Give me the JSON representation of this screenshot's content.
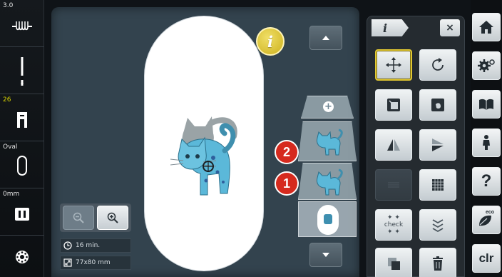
{
  "left_status": {
    "stitch_length_value": "3.0",
    "needle_value": "",
    "thread_value": "26",
    "hoop_value": "Oval",
    "offset_value": "0mm"
  },
  "workspace": {
    "info_button_label": "i",
    "embroidery_time": "16 min.",
    "embroidery_size": "77x80 mm",
    "layer_badges": [
      "2",
      "1"
    ],
    "add_layer_label": "+"
  },
  "tool_panel": {
    "tab_label": "i",
    "close_label": "×",
    "check_label_line1": "✦ ✦",
    "check_label_word": "check",
    "check_label_line2": "✦ ✦",
    "tools": [
      {
        "icon": "move-icon",
        "state": "selected"
      },
      {
        "icon": "rotate-icon",
        "state": "enabled"
      },
      {
        "icon": "resize-icon",
        "state": "enabled"
      },
      {
        "icon": "hoop-layout-icon",
        "state": "enabled"
      },
      {
        "icon": "mirror-horizontal-icon",
        "state": "enabled"
      },
      {
        "icon": "mirror-vertical-icon",
        "state": "enabled"
      },
      {
        "icon": "edit-disabled-icon",
        "state": "disabled"
      },
      {
        "icon": "fill-pattern-icon",
        "state": "enabled"
      },
      {
        "icon": "check-position-icon",
        "state": "enabled"
      },
      {
        "icon": "color-layers-icon",
        "state": "enabled"
      },
      {
        "icon": "duplicate-icon",
        "state": "enabled"
      },
      {
        "icon": "delete-icon",
        "state": "enabled"
      }
    ]
  },
  "nav": {
    "items": [
      "home-icon",
      "settings-icon",
      "guide-icon",
      "tutorial-icon",
      "help-icon",
      "eco-icon",
      "clear-icon"
    ],
    "help_label": "?",
    "eco_label": "eco",
    "clr_label": "clr"
  },
  "colors": {
    "workspace_bg": "#33434e",
    "badge_red": "#d62a1e",
    "accent_gold": "#e2c832",
    "thread_yellow": "#d9d400",
    "cat_blue": "#5bb8d9",
    "cat_grey": "#9aa3a6"
  }
}
